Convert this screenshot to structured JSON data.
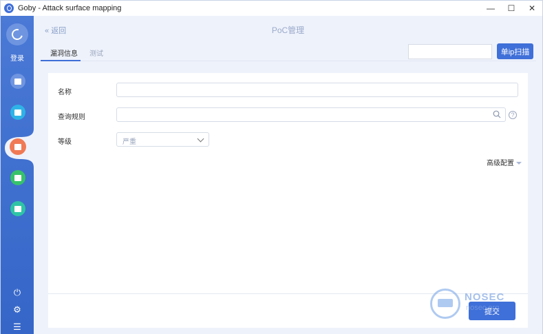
{
  "window": {
    "title": "Goby - Attack surface mapping",
    "controls": [
      "—",
      "☐",
      "✕"
    ]
  },
  "sidebar": {
    "login_label": "登录",
    "items": [
      {
        "name": "sidebar-item-assets",
        "color": "#6f95e0"
      },
      {
        "name": "sidebar-item-list",
        "color": "#2fb3e6"
      },
      {
        "name": "sidebar-item-poc",
        "color": "#f07a55"
      },
      {
        "name": "sidebar-item-report",
        "color": "#37c26a"
      },
      {
        "name": "sidebar-item-plugin",
        "color": "#2ec4a5"
      }
    ],
    "bottom": {
      "power": "⏻",
      "settings": "⚙",
      "menu": "☰"
    }
  },
  "header": {
    "back_label": "返回",
    "back_icon": "«",
    "page_title": "PoC管理"
  },
  "tabs": [
    {
      "label": "漏洞信息",
      "active": true
    },
    {
      "label": "测试",
      "active": false
    }
  ],
  "toolbar": {
    "single_ip_scan_label": "单ip扫描",
    "ip_input_value": ""
  },
  "form": {
    "name_label": "名称",
    "name_value": "",
    "query_rule_label": "查询规则",
    "query_rule_value": "",
    "level_label": "等级",
    "level_value": "严重",
    "advanced_label": "高级配置",
    "submit_label": "提交",
    "help_icon": "?"
  },
  "watermark": {
    "text": "NOSEC",
    "subtext": "nosec.org"
  },
  "colors": {
    "accent": "#3f6fd8",
    "sidebar": "#3d6dcf"
  }
}
